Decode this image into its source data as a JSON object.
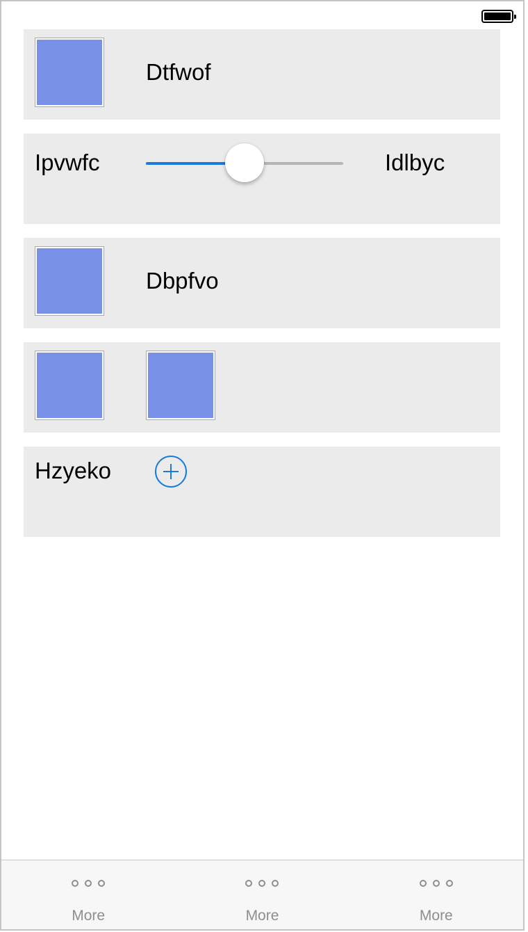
{
  "rows": {
    "row1": {
      "label": "Dtfwof"
    },
    "row2": {
      "left_label": "Ipvwfc",
      "right_label": "Idlbyc",
      "slider_value": 0.5
    },
    "row3": {
      "label": "Dbpfvo"
    },
    "row5": {
      "label": "Hzyeko"
    }
  },
  "tab_bar": {
    "tabs": [
      {
        "label": "More",
        "icon": "more-icon"
      },
      {
        "label": "More",
        "icon": "more-icon"
      },
      {
        "label": "More",
        "icon": "more-icon"
      }
    ]
  },
  "colors": {
    "accent": "#1a7ae0",
    "thumbnail": "#7890e6",
    "row_background": "#ebebeb",
    "tab_label": "#8e8e8e"
  }
}
